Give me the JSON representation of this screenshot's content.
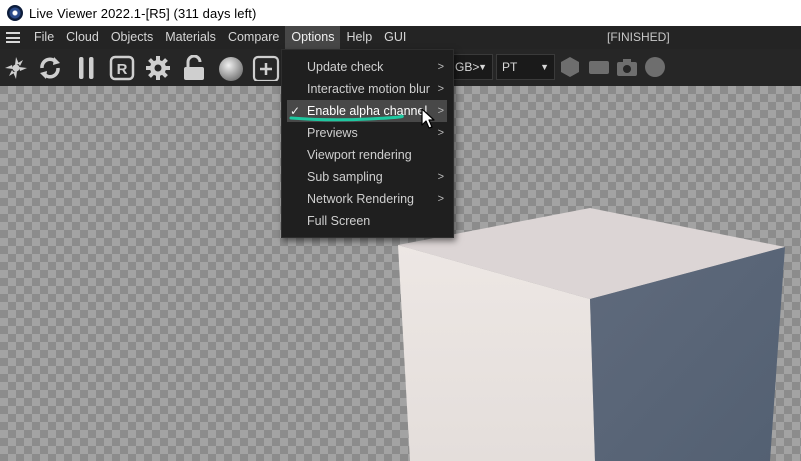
{
  "window": {
    "title": "Live Viewer 2022.1-[R5] (311 days left)"
  },
  "menubar": {
    "items": [
      "File",
      "Cloud",
      "Objects",
      "Materials",
      "Compare",
      "Options",
      "Help",
      "GUI"
    ],
    "active": "Options",
    "status": "[FINISHED]"
  },
  "toolbar": {
    "icons": [
      "gear-sync-icon",
      "refresh-icon",
      "pause-icon",
      "r-region-icon",
      "gear-icon",
      "lock-icon",
      "sphere-icon",
      "add-icon",
      "hexagon-icon",
      "rect-icon",
      "camera-icon",
      "circle-icon"
    ],
    "channel_select": "GB>",
    "kernel_select": "PT"
  },
  "options_menu": {
    "items": [
      {
        "label": "Update check",
        "submenu": true
      },
      {
        "label": "Interactive motion blur",
        "submenu": true
      },
      {
        "label": "Enable alpha channel",
        "checked": true,
        "highlighted": true,
        "submenu": true
      },
      {
        "label": "Previews",
        "submenu": true
      },
      {
        "label": "Viewport rendering",
        "submenu": false
      },
      {
        "label": "Sub sampling",
        "submenu": true
      },
      {
        "label": "Network Rendering",
        "submenu": true
      },
      {
        "label": "Full Screen",
        "submenu": false
      }
    ],
    "check_glyph": "✓",
    "arrow_glyph": ">"
  },
  "colors": {
    "annotation": "#1ec8a0",
    "menubar_bg": "#242424",
    "cube_top": "#dcd5d5",
    "cube_front": "#e8e2df",
    "cube_side": "#5a6577"
  }
}
